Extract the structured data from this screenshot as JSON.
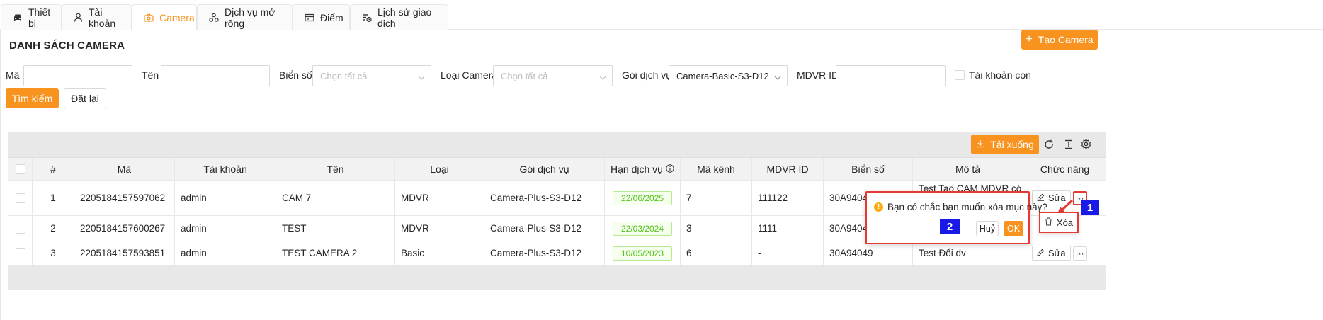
{
  "tabs": [
    {
      "label": "Thiết bị",
      "icon": "car-icon"
    },
    {
      "label": "Tài khoản",
      "icon": "user-icon"
    },
    {
      "label": "Camera",
      "icon": "camera-icon"
    },
    {
      "label": "Dịch vụ mở rộng",
      "icon": "services-icon"
    },
    {
      "label": "Điểm",
      "icon": "card-icon"
    },
    {
      "label": "Lịch sử giao dịch",
      "icon": "history-icon"
    }
  ],
  "page": {
    "title": "DANH SÁCH CAMERA",
    "create_label": "Tạo Camera"
  },
  "filters": {
    "ma_label": "Mã",
    "ma_value": "",
    "ten_label": "Tên",
    "ten_value": "",
    "bien_so_label": "Biển số",
    "bien_so_placeholder": "Chọn tất cả",
    "loai_label": "Loại Camera",
    "loai_placeholder": "Chọn tất cả",
    "goi_label": "Gói dịch vụ",
    "goi_value": "Camera-Basic-S3-D12",
    "mdvr_label": "MDVR ID",
    "mdvr_value": "",
    "sub_account_label": "Tài khoản con",
    "search_label": "Tìm kiếm",
    "reset_label": "Đặt lại"
  },
  "toolbar": {
    "download_label": "Tải xuống"
  },
  "table": {
    "headers": [
      "#",
      "Mã",
      "Tài khoản",
      "Tên",
      "Loại",
      "Gói dịch vụ",
      "Hạn dịch vụ",
      "Mã kênh",
      "MDVR ID",
      "Biển số",
      "Mô tả",
      "Chức năng"
    ],
    "rows": [
      {
        "no": "1",
        "ma": "2205184157597062",
        "account": "admin",
        "ten": "CAM 7",
        "loai": "MDVR",
        "goi": "Camera-Plus-S3-D12",
        "han": "22/06/2025",
        "kenh": "7",
        "mdvr": "111122",
        "bien_so": "30A9404",
        "mo_ta": "Test Tao CAM MDVR có trừ"
      },
      {
        "no": "2",
        "ma": "2205184157600267",
        "account": "admin",
        "ten": "TEST",
        "loai": "MDVR",
        "goi": "Camera-Plus-S3-D12",
        "han": "22/03/2024",
        "kenh": "3",
        "mdvr": "1111",
        "bien_so": "30A9404",
        "mo_ta": ""
      },
      {
        "no": "3",
        "ma": "2205184157593851",
        "account": "admin",
        "ten": "TEST CAMERA 2",
        "loai": "Basic",
        "goi": "Camera-Plus-S3-D12",
        "han": "10/05/2023",
        "kenh": "6",
        "mdvr": "-",
        "bien_so": "30A94049",
        "mo_ta": "Test Đổi dv"
      }
    ],
    "edit_label": "Sửa",
    "more_label": "···"
  },
  "popconfirm": {
    "message": "Bạn có chắc bạn muốn xóa mục này?",
    "cancel_label": "Huỷ",
    "ok_label": "OK"
  },
  "menu": {
    "delete_label": "Xóa"
  },
  "annotations": {
    "badge1": "1",
    "badge2": "2"
  },
  "colors": {
    "accent": "#f7931e",
    "highlight": "#e53935",
    "badge": "#1a1ae6",
    "date_text": "#52c41a"
  }
}
